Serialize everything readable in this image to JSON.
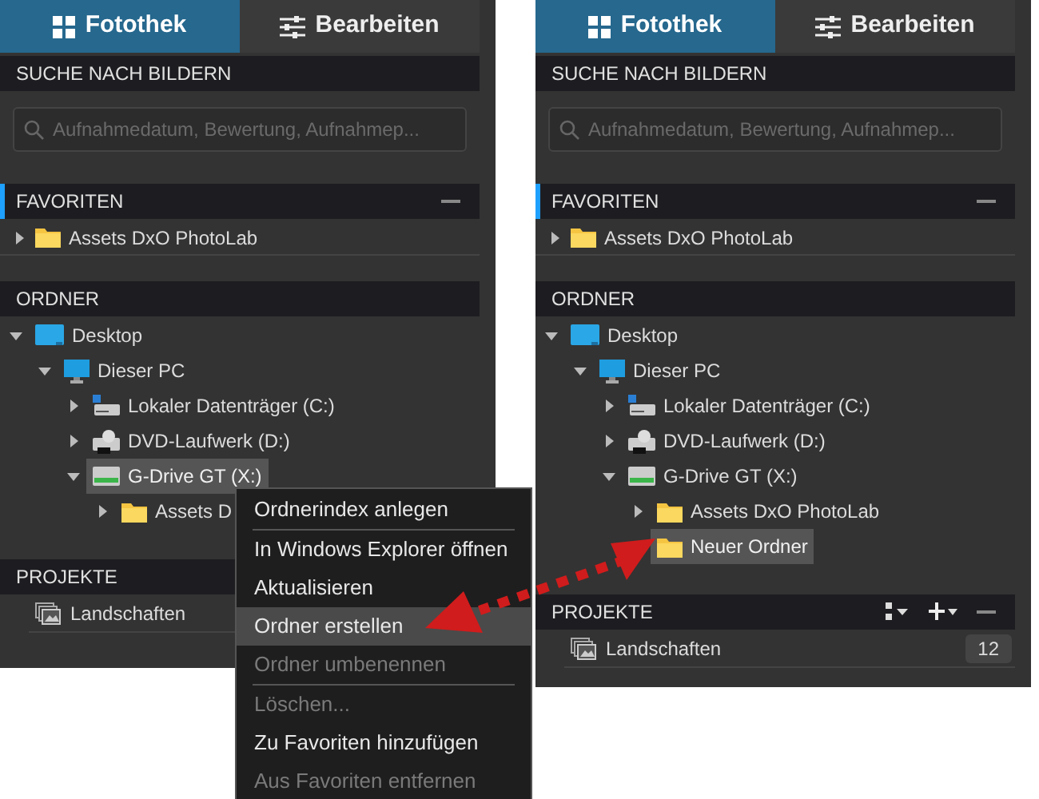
{
  "panels": [
    {
      "tabs": [
        {
          "label": "Fotothek",
          "kind": "grid",
          "selected": true
        },
        {
          "label": "Bearbeiten",
          "kind": "sliders",
          "selected": false
        }
      ],
      "search": {
        "title": "SUCHE NACH BILDERN",
        "placeholder": "Aufnahmedatum, Bewertung, Aufnahmep..."
      },
      "favorites": {
        "title": "FAVORITEN",
        "accent": true,
        "collapse": true,
        "items": [
          {
            "label": "Assets DxO PhotoLab",
            "kind": "folder",
            "expanded": false
          }
        ]
      },
      "folders": {
        "title": "ORDNER",
        "tree": [
          {
            "label": "Desktop",
            "kind": "desktop",
            "expanded": true,
            "selected": false,
            "children": [
              {
                "label": "Dieser PC",
                "kind": "pc",
                "expanded": true,
                "selected": false,
                "children": [
                  {
                    "label": "Lokaler Datenträger (C:)",
                    "kind": "disk",
                    "expanded": false,
                    "selected": false
                  },
                  {
                    "label": "DVD-Laufwerk (D:)",
                    "kind": "dvd",
                    "expanded": false,
                    "selected": false
                  },
                  {
                    "label": "G-Drive GT (X:)",
                    "kind": "drive",
                    "expanded": true,
                    "selected": true,
                    "children": [
                      {
                        "label": "Assets D",
                        "kind": "folder",
                        "expanded": false,
                        "selected": false
                      }
                    ]
                  }
                ]
              }
            ]
          }
        ]
      },
      "projects": {
        "title": "PROJEKTE",
        "items": [
          {
            "label": "Landschaften"
          }
        ]
      }
    },
    {
      "tabs": [
        {
          "label": "Fotothek",
          "kind": "grid",
          "selected": true
        },
        {
          "label": "Bearbeiten",
          "kind": "sliders",
          "selected": false
        }
      ],
      "search": {
        "title": "SUCHE NACH BILDERN",
        "placeholder": "Aufnahmedatum, Bewertung, Aufnahmep..."
      },
      "favorites": {
        "title": "FAVORITEN",
        "accent": true,
        "collapse": true,
        "items": [
          {
            "label": "Assets DxO PhotoLab",
            "kind": "folder",
            "expanded": false
          }
        ]
      },
      "folders": {
        "title": "ORDNER",
        "tree": [
          {
            "label": "Desktop",
            "kind": "desktop",
            "expanded": true,
            "selected": false,
            "children": [
              {
                "label": "Dieser PC",
                "kind": "pc",
                "expanded": true,
                "selected": false,
                "children": [
                  {
                    "label": "Lokaler Datenträger (C:)",
                    "kind": "disk",
                    "expanded": false,
                    "selected": false
                  },
                  {
                    "label": "DVD-Laufwerk (D:)",
                    "kind": "dvd",
                    "expanded": false,
                    "selected": false
                  },
                  {
                    "label": "G-Drive GT (X:)",
                    "kind": "drive",
                    "expanded": true,
                    "selected": false,
                    "children": [
                      {
                        "label": "Assets DxO PhotoLab",
                        "kind": "folder",
                        "expanded": false,
                        "selected": false
                      },
                      {
                        "label": "Neuer Ordner",
                        "kind": "folder",
                        "selected": true
                      }
                    ]
                  }
                ]
              }
            ]
          }
        ]
      },
      "projects": {
        "title": "PROJEKTE",
        "sort": true,
        "add": true,
        "collapse": true,
        "items": [
          {
            "label": "Landschaften",
            "count": "12"
          }
        ]
      }
    }
  ],
  "context_menu": {
    "items": [
      {
        "label": "Ordnerindex anlegen",
        "disabled": false,
        "selected": false,
        "separator": true
      },
      {
        "label": "In Windows Explorer öffnen",
        "disabled": false,
        "selected": false,
        "separator": false
      },
      {
        "label": "Aktualisieren",
        "disabled": false,
        "selected": false,
        "separator": false
      },
      {
        "label": "Ordner erstellen",
        "disabled": false,
        "selected": true,
        "separator": false
      },
      {
        "label": "Ordner umbenennen",
        "disabled": true,
        "selected": false,
        "separator": true
      },
      {
        "label": "Löschen...",
        "disabled": true,
        "selected": false,
        "separator": false
      },
      {
        "label": "Zu Favoriten hinzufügen",
        "disabled": false,
        "selected": false,
        "separator": false
      },
      {
        "label": "Aus Favoriten entfernen",
        "disabled": true,
        "selected": false,
        "separator": false
      }
    ]
  }
}
